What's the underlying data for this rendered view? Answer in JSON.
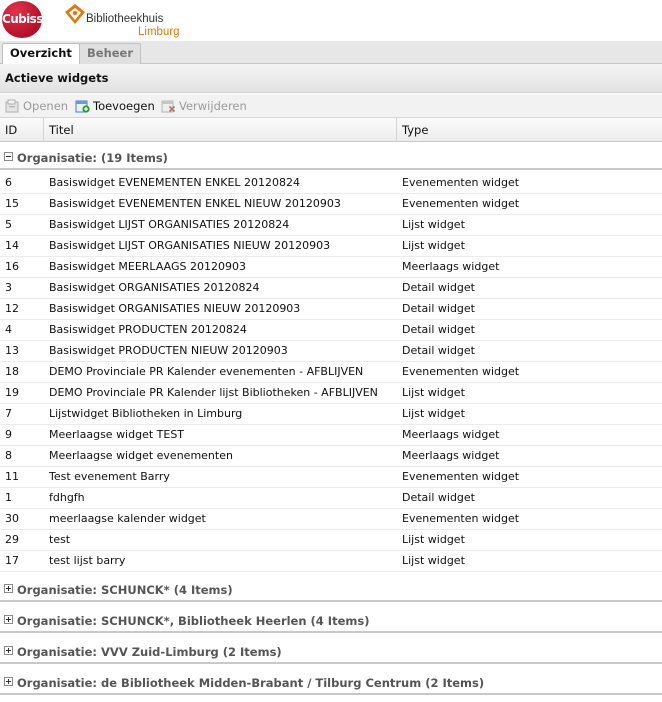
{
  "header": {
    "cubiss_logo_text": "Cubiss",
    "library_logo": {
      "name": "Bibliotheekhuis",
      "region": "Limburg"
    }
  },
  "tabs": [
    {
      "label": "Overzicht",
      "active": true
    },
    {
      "label": "Beheer",
      "active": false
    }
  ],
  "panel": {
    "title": "Actieve widgets"
  },
  "toolbar": {
    "open": {
      "label": "Openen",
      "enabled": false,
      "icon": "open-icon"
    },
    "add": {
      "label": "Toevoegen",
      "enabled": true,
      "icon": "add-icon"
    },
    "delete": {
      "label": "Verwijderen",
      "enabled": false,
      "icon": "delete-icon"
    }
  },
  "columns": {
    "id": "ID",
    "title": "Titel",
    "type": "Type"
  },
  "groups": [
    {
      "label": "Organisatie:  (19 Items)",
      "expanded": true,
      "rows": [
        {
          "id": "6",
          "title": "Basiswidget EVENEMENTEN ENKEL 20120824",
          "type": "Evenementen widget"
        },
        {
          "id": "15",
          "title": "Basiswidget EVENEMENTEN ENKEL NIEUW 20120903",
          "type": "Evenementen widget"
        },
        {
          "id": "5",
          "title": "Basiswidget LIJST ORGANISATIES 20120824",
          "type": "Lijst widget"
        },
        {
          "id": "14",
          "title": "Basiswidget LIJST ORGANISATIES NIEUW 20120903",
          "type": "Lijst widget"
        },
        {
          "id": "16",
          "title": "Basiswidget MEERLAAGS 20120903",
          "type": "Meerlaags widget"
        },
        {
          "id": "3",
          "title": "Basiswidget ORGANISATIES 20120824",
          "type": "Detail widget"
        },
        {
          "id": "12",
          "title": "Basiswidget ORGANISATIES NIEUW 20120903",
          "type": "Detail widget"
        },
        {
          "id": "4",
          "title": "Basiswidget PRODUCTEN 20120824",
          "type": "Detail widget"
        },
        {
          "id": "13",
          "title": "Basiswidget PRODUCTEN NIEUW 20120903",
          "type": "Detail widget"
        },
        {
          "id": "18",
          "title": "DEMO Provinciale PR Kalender evenementen - AFBLIJVEN",
          "type": "Evenementen widget"
        },
        {
          "id": "19",
          "title": "DEMO Provinciale PR Kalender lijst Bibliotheken - AFBLIJVEN",
          "type": "Lijst widget"
        },
        {
          "id": "7",
          "title": "Lijstwidget Bibliotheken in Limburg",
          "type": "Lijst widget"
        },
        {
          "id": "9",
          "title": "Meerlaagse widget TEST",
          "type": "Meerlaags widget"
        },
        {
          "id": "8",
          "title": "Meerlaagse widget evenementen",
          "type": "Meerlaags widget"
        },
        {
          "id": "11",
          "title": "Test evenement Barry",
          "type": "Evenementen widget"
        },
        {
          "id": "1",
          "title": "fdhgfh",
          "type": "Detail widget"
        },
        {
          "id": "30",
          "title": "meerlaagse kalender widget",
          "type": "Evenementen widget"
        },
        {
          "id": "29",
          "title": "test",
          "type": "Lijst widget"
        },
        {
          "id": "17",
          "title": "test lijst barry",
          "type": "Lijst widget"
        }
      ]
    },
    {
      "label": "Organisatie: SCHUNCK* (4 Items)",
      "expanded": false
    },
    {
      "label": "Organisatie: SCHUNCK*, Bibliotheek Heerlen (4 Items)",
      "expanded": false
    },
    {
      "label": "Organisatie: VVV Zuid-Limburg (2 Items)",
      "expanded": false
    },
    {
      "label": "Organisatie: de Bibliotheek Midden-Brabant / Tilburg Centrum (2 Items)",
      "expanded": false
    }
  ],
  "colors": {
    "cubiss_red": "#c8183a",
    "limburg_orange": "#e07a10",
    "disabled_text": "#9a9a9a"
  }
}
